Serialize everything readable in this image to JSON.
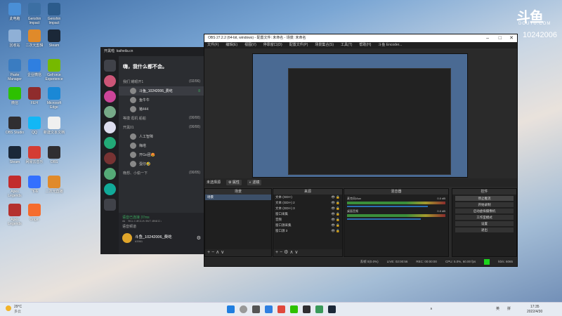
{
  "watermark": {
    "logo": "斗鱼",
    "site": "DOUYU.COM",
    "room": "10242006"
  },
  "desktop_icons": [
    {
      "label": "此电脑",
      "color": "#4a8fd6"
    },
    {
      "label": "Genshin Impact",
      "color": "#3c6fa3"
    },
    {
      "label": "Genshin Impact",
      "color": "#2b5b8b"
    },
    {
      "label": "回收站",
      "color": "#8fb0d6"
    },
    {
      "label": "二次元剪辑",
      "color": "#e08a2a"
    },
    {
      "label": "Steam",
      "color": "#1b2838"
    },
    {
      "label": "Paste Manager",
      "color": "#3a7cc1"
    },
    {
      "label": "企业微信",
      "color": "#2f7fe0"
    },
    {
      "label": "GeForce Experience",
      "color": "#76b900"
    },
    {
      "label": "微信",
      "color": "#2dc100"
    },
    {
      "label": "FEH",
      "color": "#8f2c2c"
    },
    {
      "label": "Microsoft Edge",
      "color": "#1a88d6"
    },
    {
      "label": "OBS Studio",
      "color": "#302e31"
    },
    {
      "label": "QQ",
      "color": "#12b7f5"
    },
    {
      "label": "新建文本文档",
      "color": "#f0f0f0"
    },
    {
      "label": "Steam",
      "color": "#1b2838"
    },
    {
      "label": "网易云音乐",
      "color": "#d43c33"
    },
    {
      "label": "OBS",
      "color": "#302e31"
    },
    {
      "label": "Apex Legends",
      "color": "#c22c2c"
    },
    {
      "label": "飞书",
      "color": "#3370ff"
    },
    {
      "label": "二次元直播",
      "color": "#e08a2a"
    },
    {
      "label": "Apex Legends",
      "color": "#b4312e"
    },
    {
      "label": "Origin",
      "color": "#f56c2d"
    }
  ],
  "chat": {
    "app_name": "开黑啦",
    "app_domain": "kaiheila.cn",
    "guild_name": "嗨，我什么都不会。",
    "channels": [
      {
        "name": "我们 耀眼开1",
        "count": "(02/06)",
        "members": [
          {
            "name": "斗鱼_10242006_费屹",
            "badge": "8",
            "active": true
          },
          {
            "name": "鱼牛牛",
            "badge": "",
            "active": false
          },
          {
            "name": "猪444",
            "badge": "",
            "active": false
          }
        ]
      },
      {
        "name": "等摸 逛机 船舶",
        "count": "(00/00)",
        "members": []
      },
      {
        "name": "开黑01",
        "count": "(00/00)",
        "members": [
          {
            "name": "人工智障",
            "badge": "",
            "active": false
          },
          {
            "name": "梅塔",
            "badge": "",
            "active": false
          },
          {
            "name": "开Go团😍",
            "badge": "",
            "active": false
          },
          {
            "name": "蛋仔🤣",
            "badge": "",
            "active": false
          }
        ]
      },
      {
        "name": "晚想、小偷一下",
        "count": "(00/05)",
        "members": []
      }
    ],
    "voice": {
      "status": "语音已连接 37ms",
      "channel": "嗨，我什么都不会/我们 耀眼开1"
    },
    "user": {
      "section": "语音频道",
      "name": "斗鱼_10242006_费屹",
      "tag": "#3961"
    }
  },
  "obs": {
    "title": "OBS 27.2.2 (64-bit, windows) - 配置文件: 未命名 - 场景: 未命名",
    "menu": [
      "文件(F)",
      "编辑(E)",
      "视图(V)",
      "停靠窗口(D)",
      "配置文件(P)",
      "场景集合(S)",
      "工具(T)",
      "帮助(H)",
      "斗鱼 Encoder..."
    ],
    "toolbar": {
      "no_source": "未选择源",
      "props": "属性",
      "filters": "滤镜"
    },
    "scenes": {
      "title": "场景",
      "items": [
        "场景"
      ]
    },
    "sources": {
      "title": "来源",
      "items": [
        "文本 (GDI+)",
        "文本 (GDI+) 2",
        "文本 (GDI+) 3",
        "窗口采集",
        "音频",
        "窗口源采集",
        "窗口源 3"
      ]
    },
    "mixer": {
      "title": "混音器",
      "items": [
        {
          "name": "麦克风/Aux",
          "db": "0.0 dB",
          "level": 0.82
        },
        {
          "name": "桌面音频",
          "db": "0.0 dB",
          "level": 0.75
        }
      ]
    },
    "controls": {
      "title": "控件",
      "buttons": [
        "停止推流",
        "开始录制",
        "启动虚拟摄像机",
        "工作室模式",
        "设置",
        "退出"
      ]
    },
    "status": {
      "dropped": "丢帧 0(0.0%)",
      "live": "LIVE: 02:00:56",
      "rec": "REC: 00:00:00",
      "cpu": "CPU: 5.0%, 60.00 fps",
      "kbps": "kb/s: 6065"
    }
  },
  "taskbar": {
    "weather": {
      "temp": "29°C",
      "desc": "多云"
    },
    "ime": "英",
    "ime2": "拼",
    "time": "17:35",
    "date": "2022/4/30"
  }
}
